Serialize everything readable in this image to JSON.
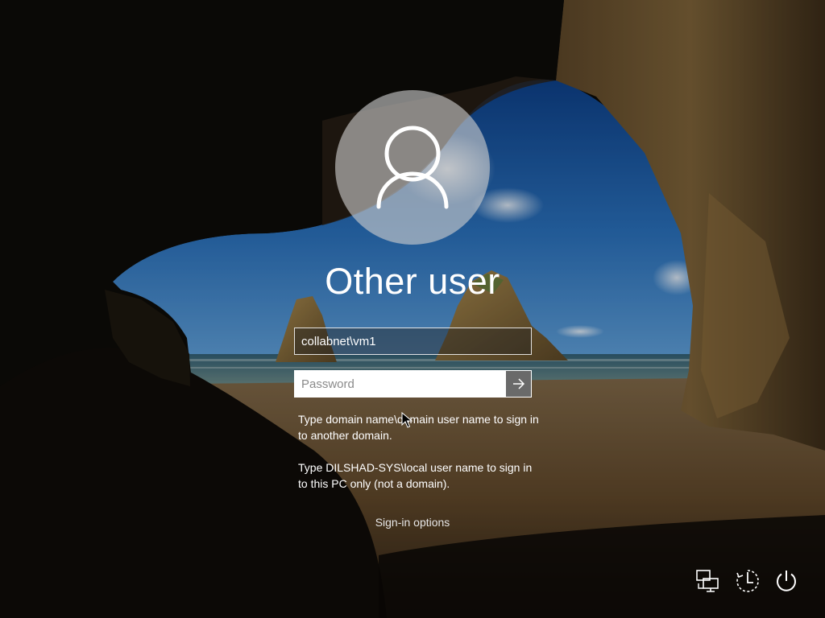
{
  "user": {
    "display_name": "Other user"
  },
  "login": {
    "username_value": "collabnet\\vm1",
    "password_placeholder": "Password"
  },
  "hints": {
    "domain_hint": "Type domain name\\domain user name to sign in to another domain.",
    "local_hint": "Type DILSHAD-SYS\\local user name to sign in to this PC only (not a domain)."
  },
  "links": {
    "sign_in_options": "Sign-in options"
  },
  "icons": {
    "avatar": "user-silhouette-icon",
    "submit": "arrow-right-icon",
    "network": "network-icon",
    "ease_of_access": "ease-of-access-icon",
    "power": "power-icon"
  },
  "colors": {
    "text": "#ffffff",
    "submit_button": "#6a6a6a",
    "field_border": "#ffffff"
  }
}
